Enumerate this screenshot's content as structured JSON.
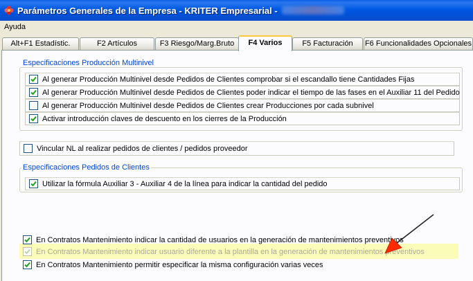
{
  "window": {
    "title": "Parámetros Generales de la Empresa - KRITER Empresarial -",
    "icon": "app-flower-icon"
  },
  "menu": {
    "items": [
      "Ayuda"
    ]
  },
  "tabs": [
    {
      "label": "Alt+F1 Estadístic.",
      "active": false
    },
    {
      "label": "F2 Artículos",
      "active": false
    },
    {
      "label": "F3 Riesgo/Marg.Bruto",
      "active": false
    },
    {
      "label": "F4 Varios",
      "active": true
    },
    {
      "label": "F5 Facturación",
      "active": false
    },
    {
      "label": "F6 Funcionalidades Opcionales",
      "active": false
    }
  ],
  "groups": {
    "produccion": {
      "label": "Especificaciones Producción Multinivel",
      "options": [
        {
          "label": "Al generar Producción Multinivel desde Pedidos de Clientes comprobar si el escandallo tiene Cantidades Fijas",
          "checked": true
        },
        {
          "label": "Al generar Producción Multinivel desde Pedidos de Clientes poder indicar el tiempo de las fases en el Auxiliar 11 del Pedido",
          "checked": true
        },
        {
          "label": "Al generar Producción Multinivel desde Pedidos de Clientes crear Producciones por cada subnivel",
          "checked": false
        },
        {
          "label": "Activar introducción claves de descuento en los cierres de la Producción",
          "checked": true
        }
      ]
    },
    "vincular": {
      "label": "Vincular NL al realizar  pedidos de clientes /  pedidos proveedor",
      "checked": false
    },
    "pedidos": {
      "label": "Especificaciones Pedidos de Clientes",
      "options": [
        {
          "label": "Utilizar la fórmula Auxiliar 3 - Auxiliar 4 de la línea para indicar la cantidad del pedido",
          "checked": true
        }
      ]
    },
    "contratos": {
      "options": [
        {
          "label": "En Contratos Mantenimiento indicar la cantidad de usuarios en la generación de mantenimientos preventivos",
          "checked": true,
          "disabled": false
        },
        {
          "label": "En Contratos Mantenimiento indicar usuario diferente a la plantilla en la generación de mantenimientos preventivos",
          "checked": true,
          "disabled": true
        },
        {
          "label": "En Contratos Mantenimiento permitir especificar la misma configuración varias veces",
          "checked": true,
          "disabled": false
        }
      ]
    }
  },
  "colors": {
    "titlebar": "#0058e2",
    "highlight": "#fbfcb8",
    "arrow": "#ff2a00",
    "group_label": "#0046d5"
  }
}
